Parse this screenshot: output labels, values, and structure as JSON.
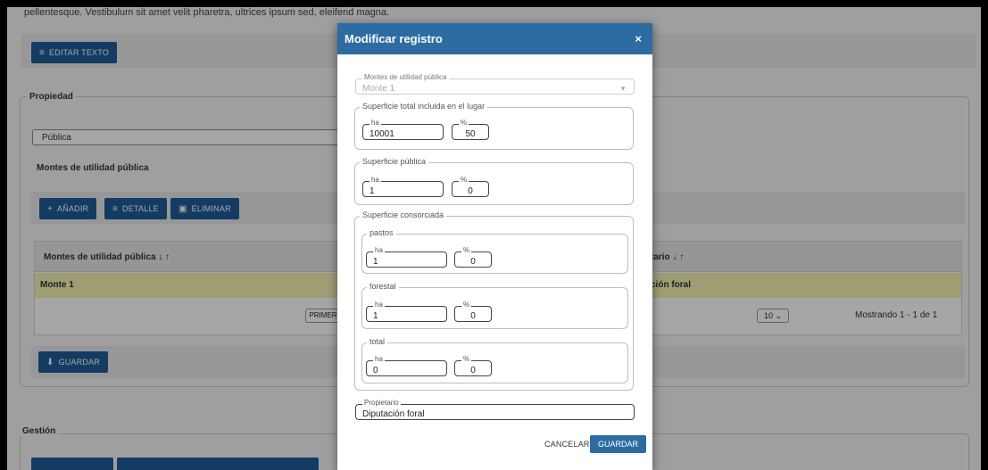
{
  "background": {
    "intro_text": "pellentesque. Vestibulum sit amet velit pharetra, ultrices ipsum sed, eleifend magna.",
    "edit_text_button": "EDITAR TEXTO",
    "propiedad_legend": "Propiedad",
    "propiedad_value": "Pública",
    "montes_label": "Montes de utilidad pública",
    "toolbar": {
      "add": "AÑADIR",
      "detail": "DETALLE",
      "delete": "ELIMINAR"
    },
    "table": {
      "col1_header": "Montes de utilidad pública ↓ ↑",
      "col2_header": "tario ↓ ↑",
      "row_col1": "Monte 1",
      "row_col2": "ción foral",
      "pager_first": "PRIMER",
      "page_size": "10",
      "showing": "Mostrando 1 - 1 de 1"
    },
    "save_button": "GUARDAR",
    "gestion_legend": "Gestión"
  },
  "modal": {
    "title": "Modificar registro",
    "close": "×",
    "monte_field": {
      "label": "Montes de utilidad pública",
      "value": "Monte 1"
    },
    "superficie_total": {
      "legend": "Superficie total incluida en el lugar",
      "ha_label": "ha",
      "ha_value": "10001",
      "pct_label": "%",
      "pct_value": "50"
    },
    "superficie_publica": {
      "legend": "Superficie pública",
      "ha_label": "ha",
      "ha_value": "1",
      "pct_label": "%",
      "pct_value": "0"
    },
    "superficie_consorciada": {
      "legend": "Superficie consorciada",
      "pastos": {
        "legend": "pastos",
        "ha_label": "ha",
        "ha_value": "1",
        "pct_label": "%",
        "pct_value": "0"
      },
      "forestal": {
        "legend": "forestal",
        "ha_label": "ha",
        "ha_value": "1",
        "pct_label": "%",
        "pct_value": "0"
      },
      "total": {
        "legend": "total",
        "ha_label": "ha",
        "ha_value": "0",
        "pct_label": "%",
        "pct_value": "0"
      }
    },
    "propietario": {
      "label": "Propietario",
      "value": "Diputación foral"
    },
    "cancel_label": "CANCELAR",
    "save_label": "GUARDAR"
  },
  "colors": {
    "primary": "#2d6ca3",
    "selected_row": "#f5f1b3"
  },
  "icons": {
    "edit": "edit-text-icon",
    "add": "plus-icon",
    "detail": "detail-icon",
    "delete": "trash-icon",
    "save": "download-icon",
    "close": "close-icon"
  }
}
